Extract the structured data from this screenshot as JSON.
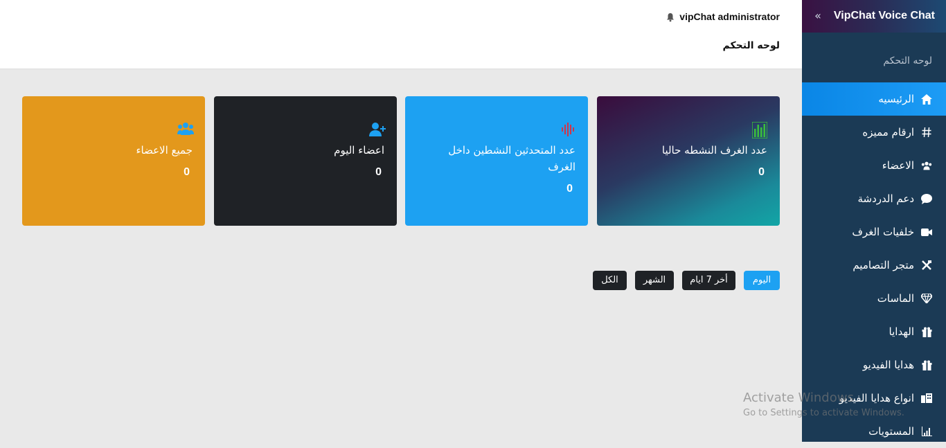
{
  "header": {
    "admin_name": "vipChat administrator",
    "page_title": "لوحه التحكم"
  },
  "sidebar": {
    "brand": "VipChat Voice Chat",
    "heading": "لوحه التحكم",
    "items": [
      {
        "label": "الرئيسيه",
        "icon": "home-icon",
        "active": true
      },
      {
        "label": "ارقام مميزه",
        "icon": "hash-icon"
      },
      {
        "label": "الاعضاء",
        "icon": "users-icon"
      },
      {
        "label": "دعم الدردشة",
        "icon": "chat-bubble-icon"
      },
      {
        "label": "خلفيات الغرف",
        "icon": "video-camera-icon"
      },
      {
        "label": "متجر التصاميم",
        "icon": "tools-icon"
      },
      {
        "label": "الماسات",
        "icon": "diamond-icon"
      },
      {
        "label": "الهدايا",
        "icon": "gift-icon"
      },
      {
        "label": "هدايا الفيديو",
        "icon": "gift-icon"
      },
      {
        "label": "انواع هدايا الفيديو",
        "icon": "building-icon"
      },
      {
        "label": "المستويات",
        "icon": "bar-chart-icon"
      }
    ]
  },
  "cards": [
    {
      "label": "عدد الغرف النشطه حاليا",
      "value": "0",
      "icon": "equalizer-icon"
    },
    {
      "label": "عدد المتحدثين النشطين داخل الغرف",
      "value": "0",
      "icon": "sound-wave-icon"
    },
    {
      "label": "اعضاء اليوم",
      "value": "0",
      "icon": "user-plus-icon"
    },
    {
      "label": "جميع الاعضاء",
      "value": "0",
      "icon": "users-icon"
    }
  ],
  "filters": {
    "today": "اليوم",
    "week": "أخر 7 ايام",
    "month": "الشهر",
    "all": "الكل"
  },
  "watermark": {
    "line1": "Activate Windows",
    "line2": "Go to Settings to activate Windows."
  },
  "colors": {
    "sidebar_bg": "#1b3a55",
    "accent_blue": "#1da1f2",
    "card_dark": "#1f2226",
    "card_orange": "#e3981c",
    "equalizer_green": "#3bbf3b",
    "wave_red": "#d0344a"
  }
}
